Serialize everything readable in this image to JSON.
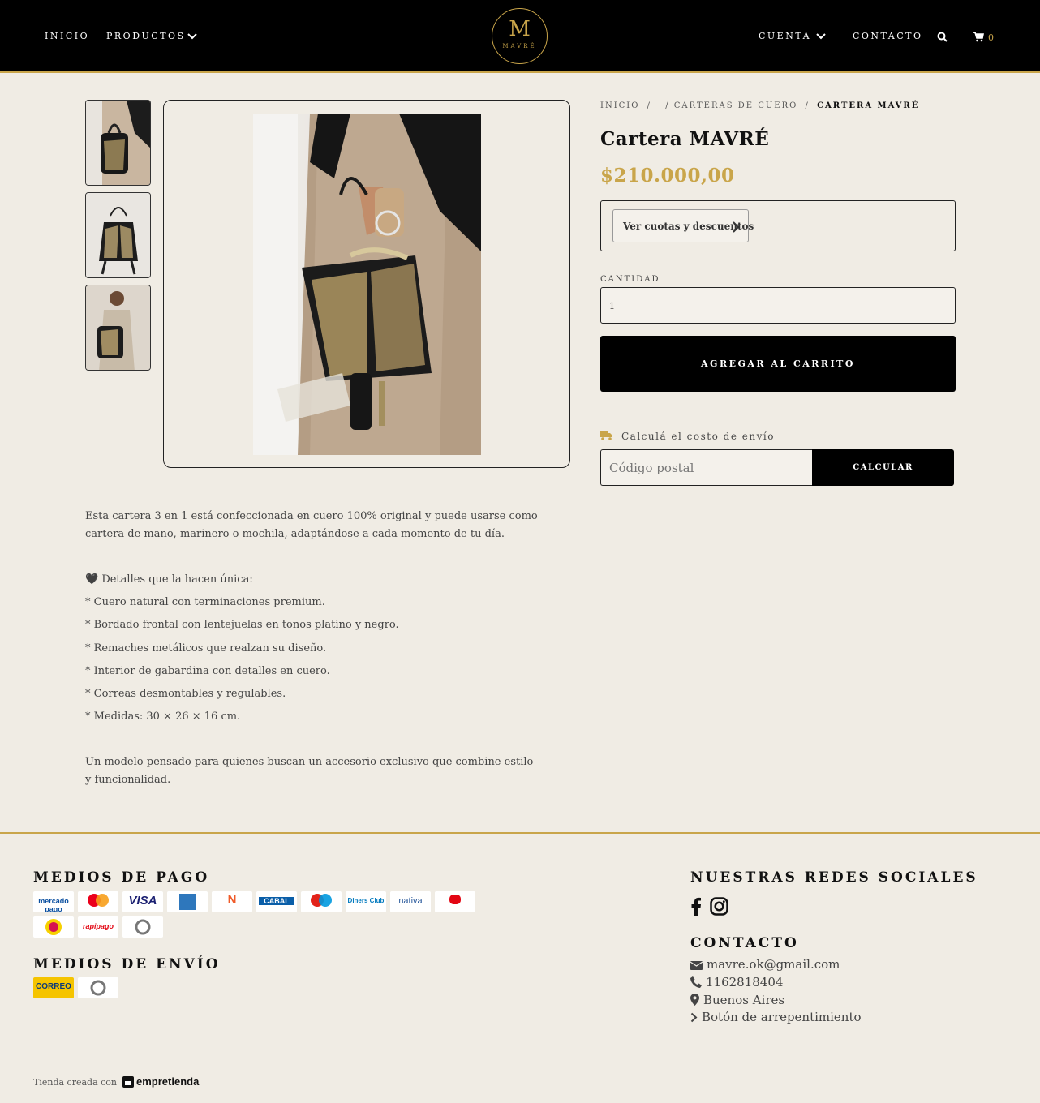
{
  "header": {
    "nav_left": [
      "INICIO",
      "PRODUCTOS"
    ],
    "nav_right": [
      "CUENTA",
      "CONTACTO"
    ],
    "logo_letter": "M",
    "logo_text": "MAVRÉ",
    "cart_count": "0",
    "icons": [
      "chevron-down-icon",
      "search-icon",
      "cart-icon"
    ]
  },
  "breadcrumb": {
    "items": [
      "INICIO",
      "/",
      "/ CARTERAS DE CUERO",
      "/",
      "CARTERA MAVRÉ"
    ]
  },
  "product": {
    "title": "Cartera MAVRÉ",
    "price": "$210.000,00",
    "installments_label": "Ver cuotas y descuentos",
    "quantity_label": "CANTIDAD",
    "quantity_value": "1",
    "add_to_cart": "AGREGAR AL CARRITO",
    "shipping_label": "Calculá el costo de envío",
    "zip_placeholder": "Código postal",
    "calculate": "CALCULAR"
  },
  "description": {
    "intro": "Esta cartera 3 en 1 está confeccionada en cuero 100% original y puede usarse como cartera de mano, marinero o mochila, adaptándose a cada momento de tu día.",
    "details_title": "🖤 Detalles que la hacen única:",
    "details": [
      "* Cuero natural con terminaciones premium.",
      "* Bordado frontal con lentejuelas en tonos platino y negro.",
      "* Remaches metálicos que realzan su diseño.",
      "* Interior de gabardina con detalles en cuero.",
      "* Correas desmontables y regulables.",
      "* Medidas: 30 × 26 × 16 cm."
    ],
    "closing": "Un modelo pensado para quienes buscan un accesorio exclusivo que combine estilo y funcionalidad."
  },
  "footer": {
    "payment_title": "MEDIOS DE PAGO",
    "payment_logos": [
      "mercado pago",
      "mastercard",
      "VISA",
      "AMEX",
      "Naranja",
      "CABAL",
      "maestro",
      "Diners Club",
      "nativa",
      "Argencard",
      "Pago Fácil",
      "rapipago",
      "efectivo"
    ],
    "shipping_title": "MEDIOS DE ENVÍO",
    "shipping_logos": [
      "CORREO ARGENTINO",
      "envío"
    ],
    "social_title": "NUESTRAS REDES SOCIALES",
    "social_icons": [
      "facebook-icon",
      "instagram-icon"
    ],
    "contact_title": "CONTACTO",
    "contact": {
      "email": "mavre.ok@gmail.com",
      "phone": "1162818404",
      "location": "Buenos Aires",
      "regret": "Botón de arrepentimiento"
    },
    "credit_prefix": "Tienda creada con",
    "credit_brand": "empretienda"
  },
  "colors": {
    "accent_gold": "#c9a54a",
    "header_bg": "#000000",
    "page_bg": "#f0ece4"
  }
}
